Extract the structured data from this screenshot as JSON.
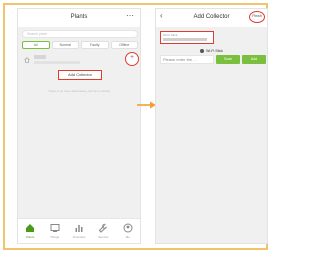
{
  "left_screen": {
    "title": "Plants",
    "more_icon": "ellipsis-icon",
    "search_placeholder": "Search plant",
    "tabs": [
      {
        "label": "All"
      },
      {
        "label": "Normal"
      },
      {
        "label": "Faulty"
      },
      {
        "label": "Offline"
      }
    ],
    "add_icon": "plus-icon",
    "menu_item_label": "Add Collector",
    "empty_text": "There is no more data below, pull up to refresh",
    "bottom_nav": [
      {
        "label": "Plants",
        "icon": "home-icon",
        "active": true
      },
      {
        "label": "Things",
        "icon": "devices-icon",
        "active": false
      },
      {
        "label": "Overview",
        "icon": "bar-chart-icon",
        "active": false
      },
      {
        "label": "Service",
        "icon": "wrench-icon",
        "active": false
      },
      {
        "label": "Me",
        "icon": "user-icon",
        "active": false
      }
    ]
  },
  "right_screen": {
    "title": "Add Collector",
    "back_icon": "chevron-left-icon",
    "finish_label": "Finish",
    "wifi_label": "Wi-Fi Stick",
    "wifi_option_label": "Wi-Fi Stick",
    "input_placeholder": "Please enter the ...",
    "green_button_1": "Scan",
    "green_button_2": "Add"
  },
  "colors": {
    "frame_border": "#f1c36a",
    "highlight": "#e23b2e",
    "accent_green": "#7bbf3f",
    "arrow": "#f0a030"
  }
}
